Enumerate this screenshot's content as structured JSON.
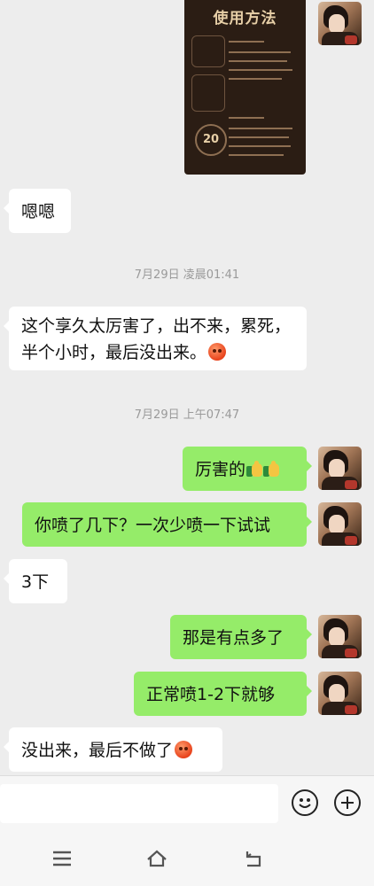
{
  "image_message": {
    "title": "使用方法",
    "timer_value": "20"
  },
  "messages": [
    {
      "id": "m1",
      "side": "in",
      "text": "嗯嗯"
    },
    {
      "id": "t1",
      "type": "time",
      "text": "7月29日 凌晨01:41"
    },
    {
      "id": "m2",
      "side": "in",
      "text": "这个享久太厉害了，出不来，累死，半个小时，最后没出来。",
      "emoji": "face-emoji"
    },
    {
      "id": "t2",
      "type": "time",
      "text": "7月29日 上午07:47"
    },
    {
      "id": "m3",
      "side": "out",
      "text": "厉害的",
      "emoji": "thumbs-up-emoji x2"
    },
    {
      "id": "m4",
      "side": "out",
      "text": "你喷了几下？一次少喷一下试试"
    },
    {
      "id": "m5",
      "side": "in",
      "text": "3下"
    },
    {
      "id": "m6",
      "side": "out",
      "text": "那是有点多了"
    },
    {
      "id": "m7",
      "side": "out",
      "text": "正常喷1-2下就够"
    },
    {
      "id": "m8",
      "side": "in",
      "text": "没出来，最后不做了",
      "emoji": "face-emoji"
    }
  ],
  "input": {
    "placeholder": ""
  },
  "icons": {
    "emoji_button": "smile-icon",
    "plus_button": "plus-icon",
    "nav_menu": "menu-icon",
    "nav_home": "home-icon",
    "nav_back": "back-icon"
  },
  "colors": {
    "bubble_out": "#95ec69",
    "bubble_in": "#ffffff",
    "background": "#ededed"
  }
}
